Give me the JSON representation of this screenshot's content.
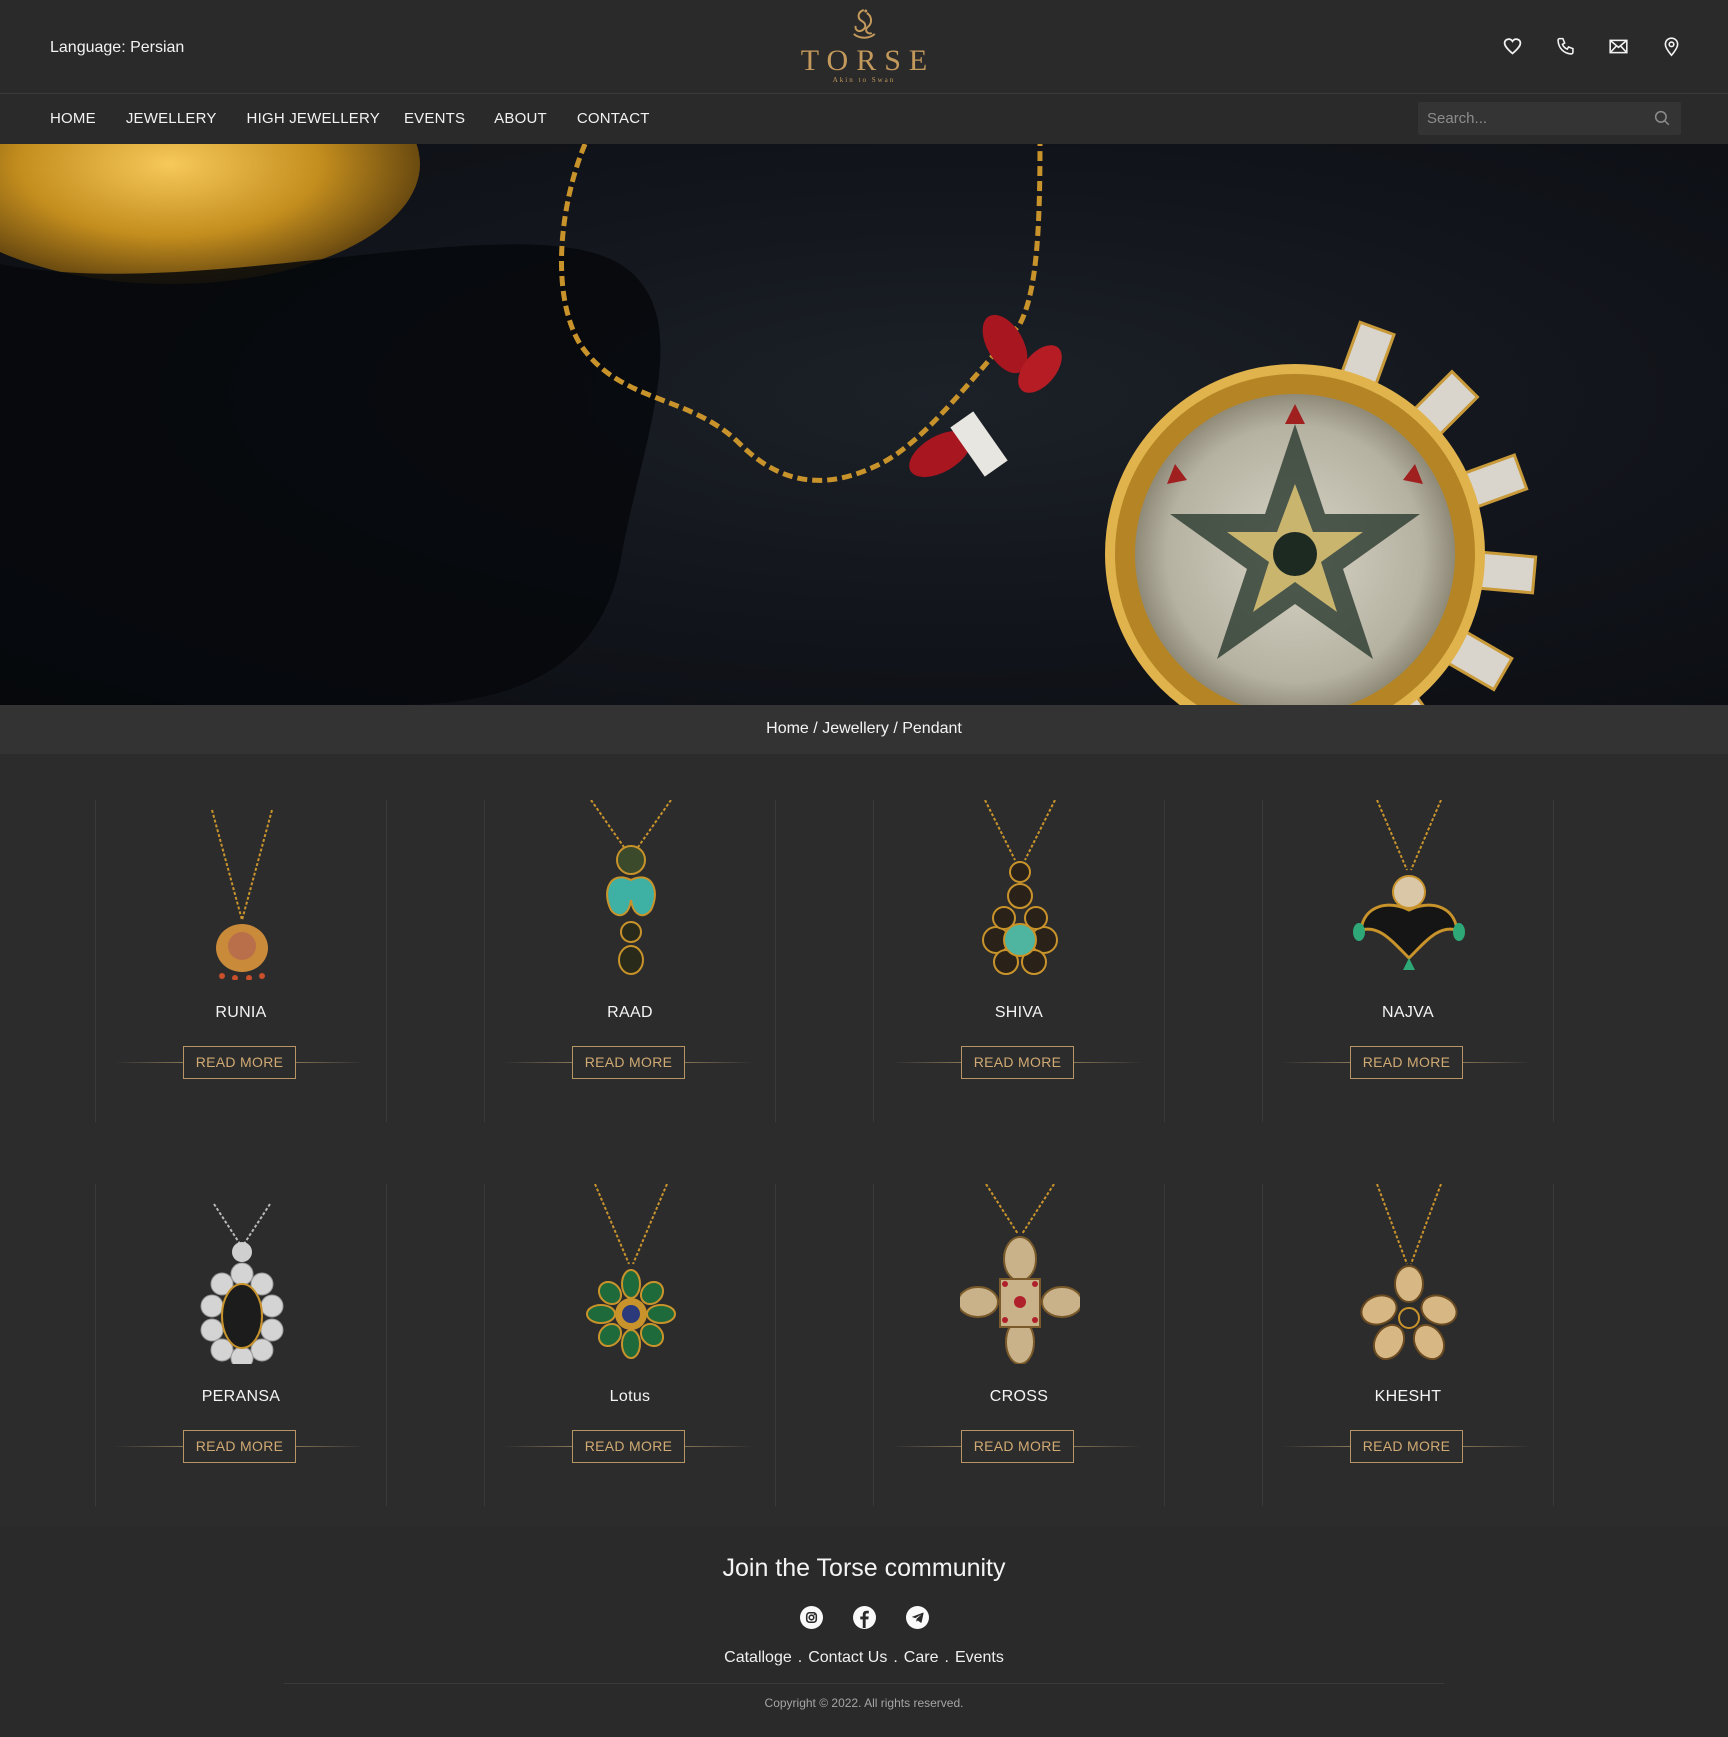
{
  "header": {
    "language_label": "Language: Persian",
    "logo_word": "TORSE",
    "logo_tagline": "Akin to Swan",
    "icons": [
      "heart-icon",
      "phone-icon",
      "mail-icon",
      "location-icon"
    ]
  },
  "nav": {
    "items": [
      {
        "label": "HOME"
      },
      {
        "label": "JEWELLERY"
      },
      {
        "label": "HIGH JEWELLERY"
      },
      {
        "label": "EVENTS"
      },
      {
        "label": "ABOUT"
      },
      {
        "label": "CONTACT"
      }
    ],
    "search_placeholder": "Search..."
  },
  "breadcrumb": {
    "home": "Home",
    "sep": "/",
    "category": "Jewellery",
    "current": "Pendant"
  },
  "products": [
    {
      "name": "RUNIA",
      "button": "READ MORE"
    },
    {
      "name": "RAAD",
      "button": "READ MORE"
    },
    {
      "name": "SHIVA",
      "button": "READ MORE"
    },
    {
      "name": "NAJVA",
      "button": "READ MORE"
    },
    {
      "name": "PERANSA",
      "button": "READ MORE"
    },
    {
      "name": "Lotus",
      "button": "READ MORE"
    },
    {
      "name": "CROSS",
      "button": "READ MORE"
    },
    {
      "name": "KHESHT",
      "button": "READ MORE"
    }
  ],
  "footer": {
    "title": "Join the Torse community",
    "socials": [
      "instagram-icon",
      "facebook-icon",
      "telegram-icon"
    ],
    "links": [
      "Catalloge",
      "Contact Us",
      "Care",
      "Events"
    ],
    "link_separator": ".",
    "copyright": "Copyright © 2022. All rights reserved."
  },
  "colors": {
    "background": "#2c2c2d",
    "accent_gold": "#c49a5c",
    "button_border": "#b79463"
  }
}
